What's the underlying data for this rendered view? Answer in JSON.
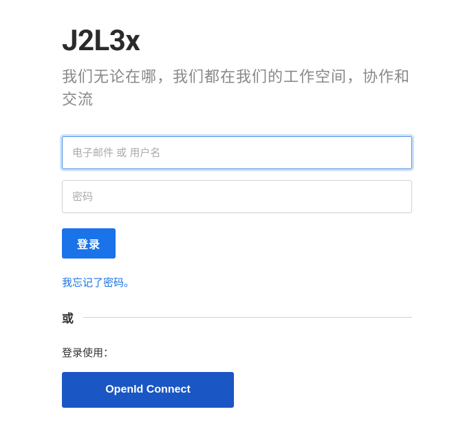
{
  "brand": "J2L3x",
  "tagline": "我们无论在哪，我们都在我们的工作空间，协作和交流",
  "form": {
    "username_placeholder": "电子邮件 或 用户名",
    "password_placeholder": "密码",
    "login_label": "登录"
  },
  "forgot_password_label": "我忘记了密码。",
  "divider_label": "或",
  "login_using_label": "登录使用：",
  "openid_label": "OpenId Connect"
}
